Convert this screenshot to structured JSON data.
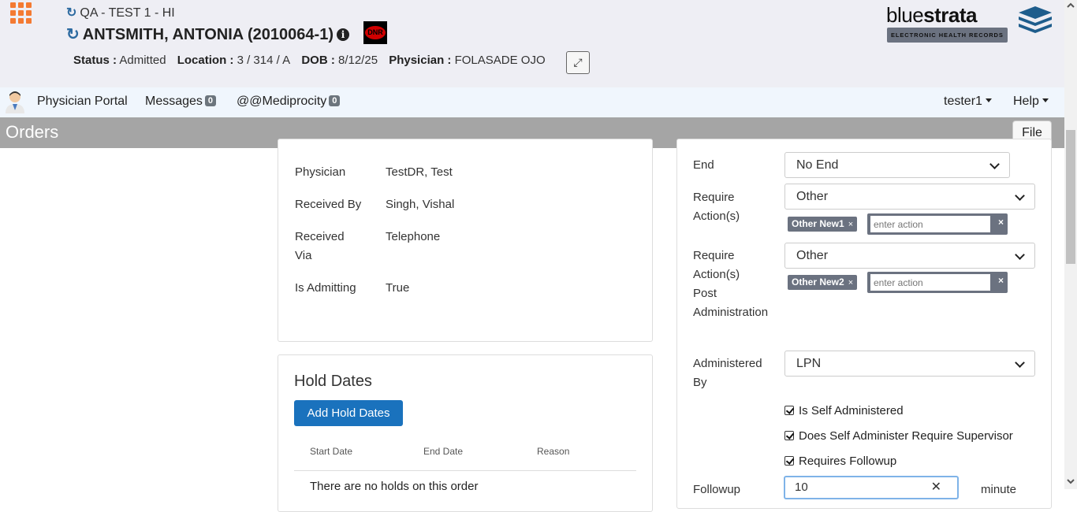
{
  "header": {
    "facility": "QA - TEST 1 - HI",
    "patient_name": "ANTSMITH, ANTONIA (2010064-1)",
    "dnr_label": "DNR",
    "status_label": "Status :",
    "status_value": "Admitted",
    "location_label": "Location :",
    "location_value": "3 / 314 / A",
    "dob_label": "DOB :",
    "dob_value": "8/12/25",
    "physician_label": "Physician :",
    "physician_value": "FOLASADE OJO",
    "logo_thin": "blue",
    "logo_bold": "strata",
    "logo_tagline": "ELECTRONIC HEALTH RECORDS"
  },
  "navbar": {
    "portal": "Physician Portal",
    "messages": "Messages",
    "messages_count": "0",
    "mediprocity": "@@Mediprocity",
    "mediprocity_count": "0",
    "user": "tester1",
    "help": "Help"
  },
  "titlebar": {
    "title": "Orders",
    "file_button": "File"
  },
  "details": {
    "rows": [
      {
        "label": "Physician",
        "value": "TestDR, Test"
      },
      {
        "label": "Received By",
        "value": "Singh, Vishal"
      },
      {
        "label": "Received Via",
        "value": "Telephone"
      },
      {
        "label": "Is Admitting",
        "value": "True"
      }
    ]
  },
  "hold_dates": {
    "title": "Hold Dates",
    "add_button": "Add Hold Dates",
    "columns": [
      "Start Date",
      "End Date",
      "Reason"
    ],
    "empty_text": "There are no holds on this order"
  },
  "form": {
    "end_label": "End",
    "end_value": "No End",
    "require_actions_label": "Require Action(s)",
    "require_actions_value": "Other",
    "require_actions_tag": "Other New1",
    "require_actions_placeholder": "enter action",
    "post_admin_label": "Require Action(s) Post Administration",
    "post_admin_value": "Other",
    "post_admin_tag": "Other New2",
    "post_admin_placeholder": "enter action",
    "administered_by_label": "Administered By",
    "administered_by_value": "LPN",
    "is_self_administered": "Is Self Administered",
    "requires_supervisor": "Does Self Administer Require Supervisor",
    "requires_followup": "Requires Followup",
    "followup_label": "Followup",
    "followup_value": "10",
    "followup_unit": "minute"
  }
}
